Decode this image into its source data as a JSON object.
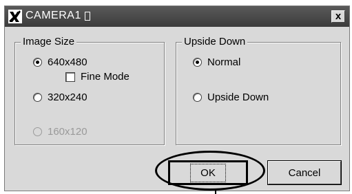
{
  "window": {
    "title": "CAMERA1",
    "close_glyph": "x"
  },
  "image_size": {
    "label": "Image Size",
    "options": [
      {
        "label": "640x480",
        "checked": true,
        "enabled": true
      },
      {
        "label": "320x240",
        "checked": false,
        "enabled": true
      },
      {
        "label": "160x120",
        "checked": false,
        "enabled": false
      }
    ],
    "fine_mode": {
      "label": "Fine Mode",
      "checked": false
    }
  },
  "upside_down": {
    "label": "Upside Down",
    "options": [
      {
        "label": "Normal",
        "checked": true
      },
      {
        "label": "Upside Down",
        "checked": false
      }
    ]
  },
  "buttons": {
    "ok": "OK",
    "cancel": "Cancel"
  },
  "icons": {
    "app": "camera-app-icon",
    "close": "close-icon"
  }
}
